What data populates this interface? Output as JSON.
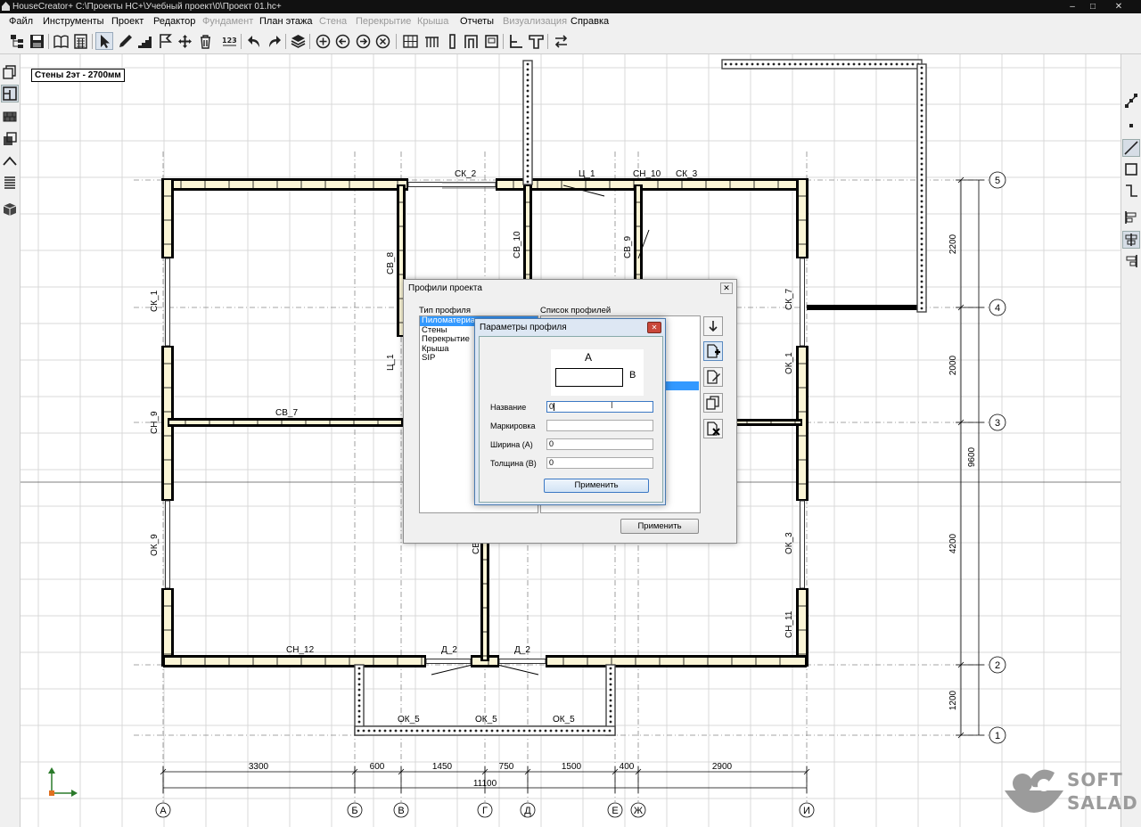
{
  "window": {
    "title": "HouseCreator+ C:\\Проекты HC+\\Учебный проект\\0\\Проект 01.hc+",
    "minimize": "–",
    "maximize": "□",
    "close": "✕"
  },
  "menu": [
    {
      "label": "Файл",
      "enabled": true
    },
    {
      "label": "Инструменты",
      "enabled": true
    },
    {
      "label": "Проект",
      "enabled": true
    },
    {
      "label": "Редактор",
      "enabled": true
    },
    {
      "label": "Фундамент",
      "enabled": false
    },
    {
      "label": "План этажа",
      "enabled": true
    },
    {
      "label": "Стена",
      "enabled": false
    },
    {
      "label": "Перекрытие",
      "enabled": false
    },
    {
      "label": "Крыша",
      "enabled": false
    },
    {
      "label": "Отчеты",
      "enabled": true
    },
    {
      "label": "Визуализация",
      "enabled": false
    },
    {
      "label": "Справка",
      "enabled": true
    }
  ],
  "toolbar_icons": [
    "project-tree-icon",
    "save-icon",
    "book-icon",
    "calculator-icon",
    "select-arrow-icon",
    "pencil-icon",
    "stairs-icon",
    "flag-icon",
    "move-icon",
    "trash-icon",
    "numbering-icon",
    "undo-icon",
    "redo-icon",
    "layers-icon",
    "zoom-in-icon",
    "zoom-back-icon",
    "zoom-forward-icon",
    "zoom-reset-icon",
    "grid-icon",
    "beam-icon",
    "column-icon",
    "frame-icon",
    "corner-icon",
    "t-profile-icon",
    "swap-icon"
  ],
  "left_tools": [
    "sheets-icon",
    "plan-icon",
    "wall-icon",
    "copy-icon",
    "roof-icon",
    "list-icon",
    "3d-icon"
  ],
  "right_tools": [
    "snap-node-icon",
    "point-icon",
    "line-icon",
    "rect-icon",
    "polyline-icon",
    "align-left-icon",
    "align-center-icon",
    "align-right-icon"
  ],
  "plan": {
    "layer_label": "Стены 2эт - 2700мм",
    "wall_labels": [
      "СК_2",
      "Ц_1",
      "СН_10",
      "СК_3",
      "СВ_8",
      "СВ_10",
      "СВ_9",
      "СК_1",
      "СВ_7",
      "СН_9",
      "Ц_1",
      "СК_7",
      "ОК_1",
      "ОК_9",
      "ОК_3",
      "СН_12",
      "Д_2",
      "Д_2",
      "ОК_5",
      "ОК_5",
      "ОК_5",
      "СН_11",
      "ОК_3",
      "СВ"
    ],
    "dimensions_bottom": [
      "3300",
      "600",
      "1450",
      "750",
      "1500",
      "400",
      "2900"
    ],
    "dimension_total_bottom": "11100",
    "dimensions_right": [
      "2200",
      "2000",
      "4200",
      "1200"
    ],
    "dimension_total_right": "9600",
    "axes_letters": [
      "А",
      "Б",
      "В",
      "Г",
      "Д",
      "Е",
      "Ж",
      "И"
    ],
    "axes_numbers": [
      "5",
      "4",
      "3",
      "2",
      "1"
    ]
  },
  "dialog_profiles": {
    "title": "Профили проекта",
    "type_label": "Тип профиля",
    "list_label": "Список профилей",
    "types": [
      "Пиломатериал",
      "Стены",
      "Перекрытие",
      "Крыша",
      "SIP"
    ],
    "selected_type": 0,
    "apply": "Применить",
    "side_buttons": [
      "move-down-icon",
      "add-profile-icon",
      "edit-profile-icon",
      "copy-profile-icon",
      "delete-profile-icon"
    ]
  },
  "dialog_params": {
    "title": "Параметры профиля",
    "diagram_a": "A",
    "diagram_b": "B",
    "fields": [
      {
        "label": "Название",
        "value": "0"
      },
      {
        "label": "Маркировка",
        "value": ""
      },
      {
        "label": "Ширина (А)",
        "value": "0"
      },
      {
        "label": "Толщина (В)",
        "value": "0"
      }
    ],
    "apply": "Применить"
  },
  "watermark": {
    "line1": "SOFT",
    "line2": "SALAD"
  }
}
